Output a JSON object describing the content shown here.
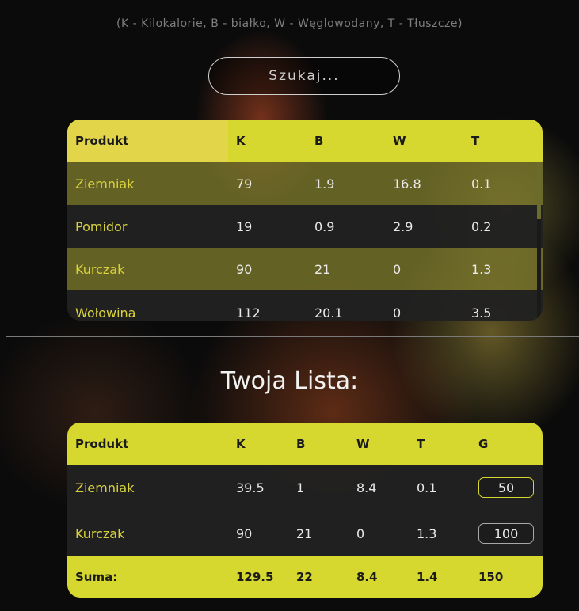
{
  "legend": "(K - Kilokalorie, B - białko, W - Węglowodany, T - Tłuszcze)",
  "search": {
    "placeholder": "Szukaj..."
  },
  "products": {
    "headers": [
      "Produkt",
      "K",
      "B",
      "W",
      "T"
    ],
    "rows": [
      [
        "Ziemniak",
        "79",
        "1.9",
        "16.8",
        "0.1"
      ],
      [
        "Pomidor",
        "19",
        "0.9",
        "2.9",
        "0.2"
      ],
      [
        "Kurczak",
        "90",
        "21",
        "0",
        "1.3"
      ],
      [
        "Wołowina",
        "112",
        "20.1",
        "0",
        "3.5"
      ]
    ]
  },
  "list_title": "Twoja Lista:",
  "list": {
    "headers": [
      "Produkt",
      "K",
      "B",
      "W",
      "T",
      "G"
    ],
    "rows": [
      [
        "Ziemniak",
        "39.5",
        "1",
        "8.4",
        "0.1",
        "50"
      ],
      [
        "Kurczak",
        "90",
        "21",
        "0",
        "1.3",
        "100"
      ]
    ],
    "sum": [
      "Suma:",
      "129.5",
      "22",
      "8.4",
      "1.4",
      "150"
    ]
  },
  "colors": {
    "accent": "#d6d82f",
    "row_highlight": "#7d7a2d",
    "row_dark": "#212121"
  }
}
